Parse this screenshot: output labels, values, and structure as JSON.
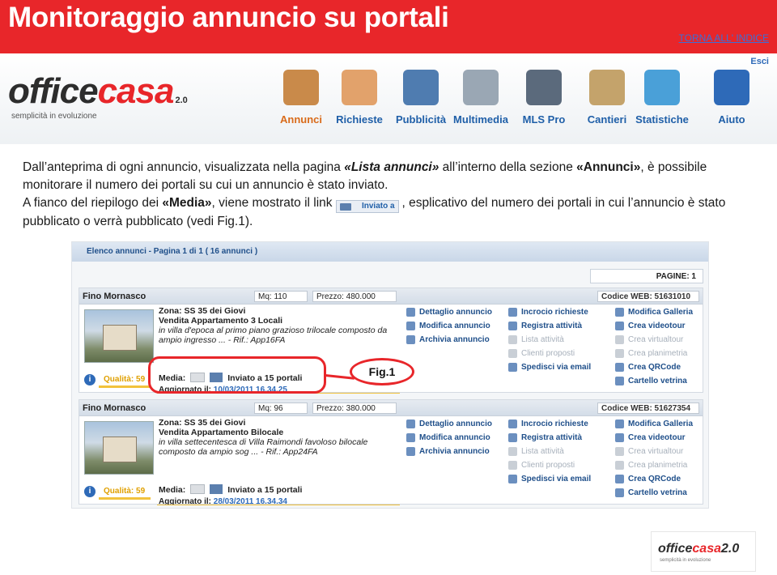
{
  "header": {
    "title": "Monitoraggio annuncio su portali",
    "back_link": "TORNA ALL' INDICE"
  },
  "brand": {
    "logo_office": "office",
    "logo_casa": "casa",
    "logo_version": "2.0",
    "tagline": "semplicità in evoluzione",
    "logout": "Esci"
  },
  "nav": {
    "items": [
      {
        "label": "Annunci",
        "icon": "house-icon",
        "color": "#c98a4a"
      },
      {
        "label": "Richieste",
        "icon": "people-icon",
        "color": "#e2a26b"
      },
      {
        "label": "Pubblicità",
        "icon": "screen-icon",
        "color": "#4f7cb0"
      },
      {
        "label": "Multimedia",
        "icon": "camera-icon",
        "color": "#9aa7b4"
      },
      {
        "label": "MLS Pro",
        "icon": "mls-icon",
        "color": "#5b6a7c"
      },
      {
        "label": "Cantieri",
        "icon": "crane-icon",
        "color": "#c4a36b"
      },
      {
        "label": "Statistiche",
        "icon": "bars-icon",
        "color": "#4aa0d8"
      },
      {
        "label": "Aiuto",
        "icon": "help-icon",
        "color": "#2e6ab8"
      }
    ]
  },
  "text": {
    "p1_a": "Dall’anteprima di ogni annuncio, visualizzata nella pagina ",
    "p1_b": "«Lista annunci»",
    "p1_c": " all’interno della sezione ",
    "p1_d": "«Annunci»",
    "p1_e": ", è possibile monitorare il numero dei portali su cui un annuncio è stato inviato.",
    "p2_a": "A fianco del riepilogo dei ",
    "p2_b": "«Media»",
    "p2_c": ", viene mostrato il link",
    "p2_link": "Inviato a",
    "p2_d": ", esplicativo del numero dei portali in cui l’annuncio è stato pubblicato o verrà pubblicato (vedi Fig.1)."
  },
  "screenshot": {
    "header": "Elenco annunci - Pagina 1 di 1 ( 16 annunci )",
    "pager": "PAGINE: 1",
    "listings": [
      {
        "city": "Fino Mornasco",
        "mq": "Mq: 110",
        "price": "Prezzo: 480.000",
        "code": "Codice WEB: 51631010",
        "zona": "Zona: SS 35 dei Giovi",
        "vendita": "Vendita Appartamento 3 Locali",
        "desc": "in villa d'epoca al primo piano grazioso trilocale composto da ampio ingresso ... - Rif.: App16FA",
        "quality": "Qualità: 59",
        "media_label": "Media:",
        "media_link": "Inviato a 15 portali",
        "updated_label": "Aggiornato il:",
        "updated": "10/03/2011 16.34.25"
      },
      {
        "city": "Fino Mornasco",
        "mq": "Mq: 96",
        "price": "Prezzo: 380.000",
        "code": "Codice WEB: 51627354",
        "zona": "Zona: SS 35 dei Giovi",
        "vendita": "Vendita Appartamento Bilocale",
        "desc": "in villa settecentesca di Villa Raimondi favoloso bilocale composto da ampio sog ... - Rif.: App24FA",
        "quality": "Qualità: 59",
        "media_label": "Media:",
        "media_link": "Inviato a 15 portali",
        "updated_label": "Aggiornato il:",
        "updated": "28/03/2011 16.34.34"
      }
    ],
    "actions_col1": [
      "Dettaglio annuncio",
      "Modifica annuncio",
      "Archivia annuncio"
    ],
    "actions_col2": [
      {
        "label": "Incrocio richieste",
        "enabled": true
      },
      {
        "label": "Registra attività",
        "enabled": true
      },
      {
        "label": "Lista attività",
        "enabled": false
      },
      {
        "label": "Clienti proposti",
        "enabled": false
      },
      {
        "label": "Spedisci via email",
        "enabled": true
      }
    ],
    "actions_col3": [
      {
        "label": "Modifica Galleria",
        "enabled": true
      },
      {
        "label": "Crea videotour",
        "enabled": true
      },
      {
        "label": "Crea virtualtour",
        "enabled": false
      },
      {
        "label": "Crea planimetria",
        "enabled": false
      },
      {
        "label": "Crea QRCode",
        "enabled": true
      },
      {
        "label": "Cartello vetrina",
        "enabled": true
      }
    ]
  },
  "figure_label": "Fig.1",
  "footer_logo": {
    "office": "office",
    "casa": "casa",
    "version": "2.0",
    "tagline": "semplicità in evoluzione"
  },
  "colors": {
    "accent": "#e8262a",
    "link": "#1f5fa8"
  }
}
